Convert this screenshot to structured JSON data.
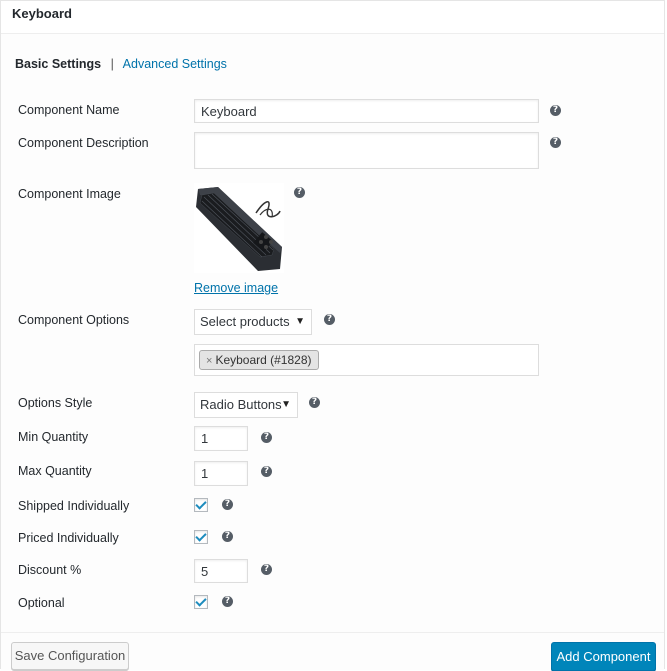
{
  "panel": {
    "title": "Keyboard"
  },
  "tabs": {
    "basic": "Basic Settings",
    "separator": "|",
    "advanced": "Advanced Settings"
  },
  "fields": {
    "component_name": {
      "label": "Component Name",
      "value": "Keyboard"
    },
    "component_description": {
      "label": "Component Description",
      "value": ""
    },
    "component_image": {
      "label": "Component Image",
      "remove_label": "Remove image"
    },
    "component_options": {
      "label": "Component Options",
      "select_value": "Select products",
      "selected_items": [
        {
          "remove": "×",
          "label": "Keyboard (#1828)"
        }
      ]
    },
    "options_style": {
      "label": "Options Style",
      "value": "Radio Buttons"
    },
    "min_quantity": {
      "label": "Min Quantity",
      "value": "1"
    },
    "max_quantity": {
      "label": "Max Quantity",
      "value": "1"
    },
    "shipped_individually": {
      "label": "Shipped Individually",
      "checked": true
    },
    "priced_individually": {
      "label": "Priced Individually",
      "checked": true
    },
    "discount": {
      "label": "Discount %",
      "value": "5"
    },
    "optional": {
      "label": "Optional",
      "checked": true
    }
  },
  "help_icon": "?",
  "caret": "▼",
  "footer": {
    "save_label": "Save Configuration",
    "add_label": "Add Component"
  },
  "colors": {
    "link": "#0073aa",
    "primary_button": "#0085ba",
    "checkmark": "#1e8cbe",
    "help_icon_bg": "#555d66"
  }
}
